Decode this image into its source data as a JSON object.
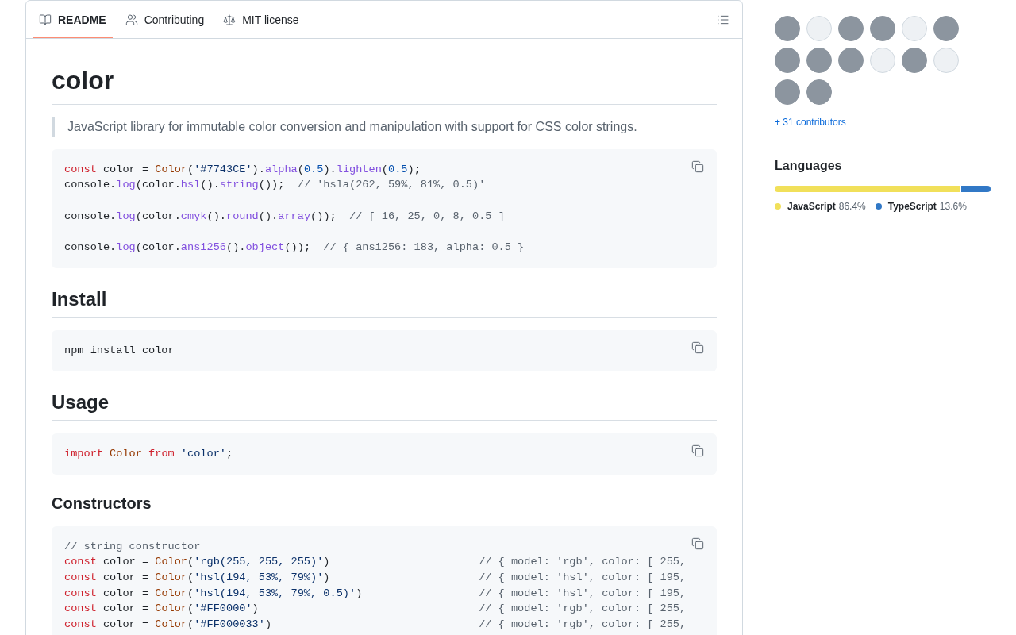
{
  "readme_header": {
    "tabs": [
      {
        "label": "README",
        "selected": true
      },
      {
        "label": "Contributing",
        "selected": false
      },
      {
        "label": "MIT license",
        "selected": false
      }
    ]
  },
  "readme": {
    "blocks": [
      {
        "kind": "h1",
        "text": "color"
      },
      {
        "kind": "blockquote",
        "text": "JavaScript library for immutable color conversion and manipulation with support for CSS color strings."
      },
      {
        "kind": "code",
        "groups": [
          [
            [
              {
                "text": "const",
                "kind": "keyword"
              },
              {
                "text": " color = ",
                "kind": "plain"
              },
              {
                "text": "Color",
                "kind": "entity"
              },
              {
                "text": "(",
                "kind": "plain"
              },
              {
                "text": "'#7743CE'",
                "kind": "string"
              },
              {
                "text": ").",
                "kind": "plain"
              },
              {
                "text": "alpha",
                "kind": "function"
              },
              {
                "text": "(",
                "kind": "plain"
              },
              {
                "text": "0.5",
                "kind": "constant"
              },
              {
                "text": ").",
                "kind": "plain"
              },
              {
                "text": "lighten",
                "kind": "function"
              },
              {
                "text": "(",
                "kind": "plain"
              },
              {
                "text": "0.5",
                "kind": "constant"
              },
              {
                "text": ");",
                "kind": "plain"
              }
            ],
            [
              {
                "text": "console.",
                "kind": "plain"
              },
              {
                "text": "log",
                "kind": "function"
              },
              {
                "text": "(color.",
                "kind": "plain"
              },
              {
                "text": "hsl",
                "kind": "function"
              },
              {
                "text": "().",
                "kind": "plain"
              },
              {
                "text": "string",
                "kind": "function"
              },
              {
                "text": "());  ",
                "kind": "plain"
              },
              {
                "text": "// 'hsla(262, 59%, 81%, 0.5)'",
                "kind": "comment"
              }
            ]
          ],
          [
            [
              {
                "text": "console.",
                "kind": "plain"
              },
              {
                "text": "log",
                "kind": "function"
              },
              {
                "text": "(color.",
                "kind": "plain"
              },
              {
                "text": "cmyk",
                "kind": "function"
              },
              {
                "text": "().",
                "kind": "plain"
              },
              {
                "text": "round",
                "kind": "function"
              },
              {
                "text": "().",
                "kind": "plain"
              },
              {
                "text": "array",
                "kind": "function"
              },
              {
                "text": "());  ",
                "kind": "plain"
              },
              {
                "text": "// [ 16, 25, 0, 8, 0.5 ]",
                "kind": "comment"
              }
            ]
          ],
          [
            [
              {
                "text": "console.",
                "kind": "plain"
              },
              {
                "text": "log",
                "kind": "function"
              },
              {
                "text": "(color.",
                "kind": "plain"
              },
              {
                "text": "ansi256",
                "kind": "function"
              },
              {
                "text": "().",
                "kind": "plain"
              },
              {
                "text": "object",
                "kind": "function"
              },
              {
                "text": "());  ",
                "kind": "plain"
              },
              {
                "text": "// { ansi256: 183, alpha: 0.5 }",
                "kind": "comment"
              }
            ]
          ]
        ]
      },
      {
        "kind": "h2",
        "text": "Install"
      },
      {
        "kind": "code",
        "groups": [
          [
            [
              {
                "text": "npm install color",
                "kind": "plain"
              }
            ]
          ]
        ]
      },
      {
        "kind": "h2",
        "text": "Usage"
      },
      {
        "kind": "code",
        "groups": [
          [
            [
              {
                "text": "import ",
                "kind": "keyword"
              },
              {
                "text": "Color ",
                "kind": "entity"
              },
              {
                "text": "from ",
                "kind": "keyword"
              },
              {
                "text": "'color'",
                "kind": "string"
              },
              {
                "text": ";",
                "kind": "plain"
              }
            ]
          ]
        ]
      },
      {
        "kind": "h3",
        "text": "Constructors"
      },
      {
        "kind": "code",
        "groups": [
          [
            [
              {
                "text": "// string constructor",
                "kind": "comment"
              }
            ],
            [
              {
                "text": "const",
                "kind": "keyword"
              },
              {
                "text": " color = ",
                "kind": "plain"
              },
              {
                "text": "Color",
                "kind": "entity"
              },
              {
                "text": "(",
                "kind": "plain"
              },
              {
                "text": "'rgb(255, 255, 255)'",
                "kind": "string"
              },
              {
                "text": ")                       ",
                "kind": "plain"
              },
              {
                "text": "// { model: 'rgb', color: [ 255,",
                "kind": "comment"
              }
            ],
            [
              {
                "text": "const",
                "kind": "keyword"
              },
              {
                "text": " color = ",
                "kind": "plain"
              },
              {
                "text": "Color",
                "kind": "entity"
              },
              {
                "text": "(",
                "kind": "plain"
              },
              {
                "text": "'hsl(194, 53%, 79%)'",
                "kind": "string"
              },
              {
                "text": ")                       ",
                "kind": "plain"
              },
              {
                "text": "// { model: 'hsl', color: [ 195,",
                "kind": "comment"
              }
            ],
            [
              {
                "text": "const",
                "kind": "keyword"
              },
              {
                "text": " color = ",
                "kind": "plain"
              },
              {
                "text": "Color",
                "kind": "entity"
              },
              {
                "text": "(",
                "kind": "plain"
              },
              {
                "text": "'hsl(194, 53%, 79%, 0.5)'",
                "kind": "string"
              },
              {
                "text": ")                  ",
                "kind": "plain"
              },
              {
                "text": "// { model: 'hsl', color: [ 195,",
                "kind": "comment"
              }
            ],
            [
              {
                "text": "const",
                "kind": "keyword"
              },
              {
                "text": " color = ",
                "kind": "plain"
              },
              {
                "text": "Color",
                "kind": "entity"
              },
              {
                "text": "(",
                "kind": "plain"
              },
              {
                "text": "'#FF0000'",
                "kind": "string"
              },
              {
                "text": ")                                  ",
                "kind": "plain"
              },
              {
                "text": "// { model: 'rgb', color: [ 255,",
                "kind": "comment"
              }
            ],
            [
              {
                "text": "const",
                "kind": "keyword"
              },
              {
                "text": " color = ",
                "kind": "plain"
              },
              {
                "text": "Color",
                "kind": "entity"
              },
              {
                "text": "(",
                "kind": "plain"
              },
              {
                "text": "'#FF000033'",
                "kind": "string"
              },
              {
                "text": ")                                ",
                "kind": "plain"
              },
              {
                "text": "// { model: 'rgb', color: [ 255,",
                "kind": "comment"
              }
            ]
          ]
        ]
      }
    ]
  },
  "sidebar": {
    "contributors": {
      "avatars": [
        {
          "kind": "photo"
        },
        {
          "kind": "picture"
        },
        {
          "kind": "photo"
        },
        {
          "kind": "photo"
        },
        {
          "kind": "picture"
        },
        {
          "kind": "photo"
        },
        {
          "kind": "photo"
        },
        {
          "kind": "photo"
        },
        {
          "kind": "photo"
        },
        {
          "kind": "picture"
        },
        {
          "kind": "photo"
        },
        {
          "kind": "picture"
        },
        {
          "kind": "photo"
        },
        {
          "kind": "photo"
        }
      ],
      "more_link": "+ 31 contributors"
    },
    "languages": {
      "title": "Languages",
      "items": [
        {
          "name": "JavaScript",
          "percent": "86.4%",
          "level": 0.864,
          "color": "#f1e05a"
        },
        {
          "name": "TypeScript",
          "percent": "13.6%",
          "level": 0.136,
          "color": "#3178c6"
        }
      ]
    }
  }
}
